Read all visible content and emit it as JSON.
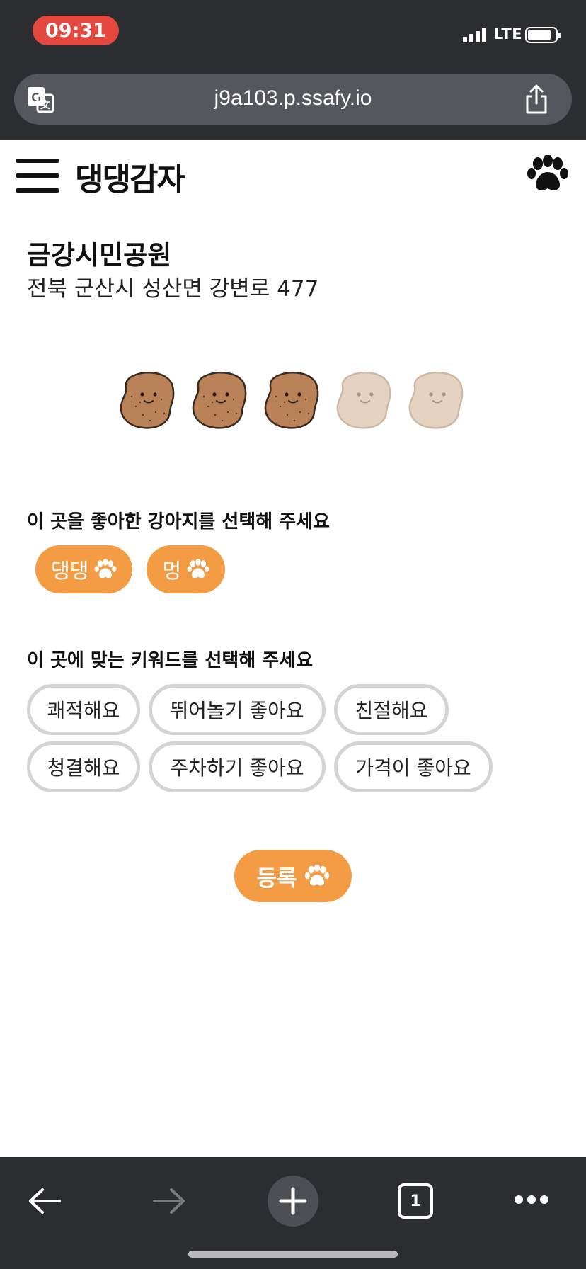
{
  "status_bar": {
    "time": "09:31",
    "network": "LTE",
    "time_pill_color": "#e5483e"
  },
  "browser": {
    "url": "j9a103.p.ssafy.io",
    "tab_count": "1"
  },
  "header": {
    "brand": "댕댕감자"
  },
  "place": {
    "name": "금강시민공원",
    "address": "전북 군산시 성산면 강변로 477"
  },
  "rating": {
    "value": 3,
    "max": 5
  },
  "dog_section": {
    "title": "이 곳을 좋아한 강아지를 선택해 주세요",
    "dogs": [
      "댕댕",
      "멍"
    ]
  },
  "keyword_section": {
    "title": "이 곳에 맞는 키워드를 선택해 주세요",
    "keywords": [
      "쾌적해요",
      "뛰어놀기 좋아요",
      "친절해요",
      "청결해요",
      "주차하기 좋아요",
      "가격이 좋아요"
    ]
  },
  "submit": {
    "label": "등록"
  },
  "colors": {
    "accent": "#f39c44",
    "chip_border": "#d4d4d4",
    "bar_bg": "#2c2d31"
  }
}
